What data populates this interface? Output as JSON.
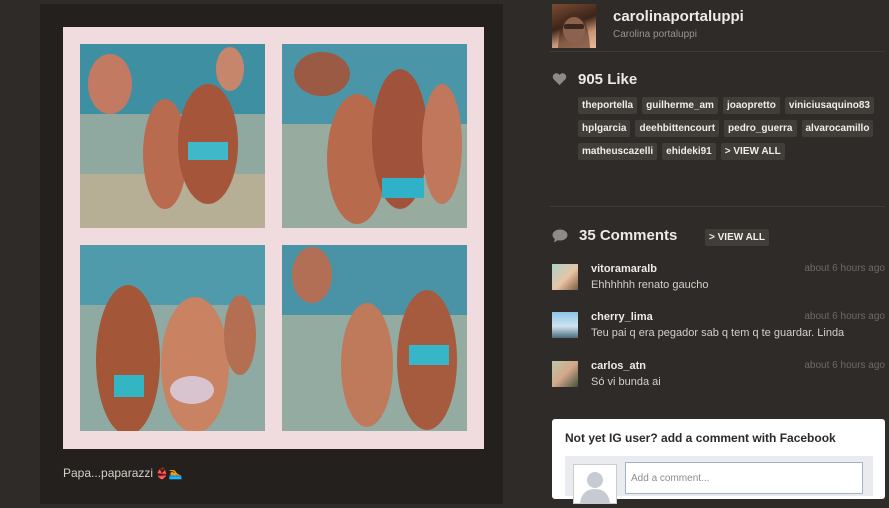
{
  "post": {
    "caption": "Papa...paparazzi",
    "caption_emoji_1": "👙",
    "caption_emoji_2": "🏊"
  },
  "profile": {
    "username": "carolinaportaluppi",
    "full_name": "Carolina portaluppi"
  },
  "likes": {
    "count_label": "905 Like",
    "users": [
      "theportella",
      "guilherme_am",
      "joaopretto",
      "viniciusaquino83",
      "hplgarcia",
      "deehbittencourt",
      "pedro_guerra",
      "alvarocamillo",
      "matheuscazelli",
      "ehideki91"
    ],
    "view_all_label": "> VIEW ALL"
  },
  "comments": {
    "count_label": "35 Comments",
    "view_all_label": "> VIEW ALL",
    "items": [
      {
        "user": "vitoramaralb",
        "time": "about 6 hours ago",
        "text": "Ehhhhhh renato gaucho"
      },
      {
        "user": "cherry_lima",
        "time": "about 6 hours ago",
        "text": "Teu pai q era pegador sab q tem q te guardar. Linda"
      },
      {
        "user": "carlos_atn",
        "time": "about 6 hours ago",
        "text": "Só vi bunda ai"
      }
    ]
  },
  "facebook_box": {
    "title": "Not yet IG user? add a comment with Facebook",
    "placeholder": "Add a comment..."
  },
  "colors": {
    "page_bg": "#2e2b28",
    "panel_bg": "#23201d",
    "tag_bg": "#413d39",
    "frame_pink": "#f0dcdf"
  }
}
